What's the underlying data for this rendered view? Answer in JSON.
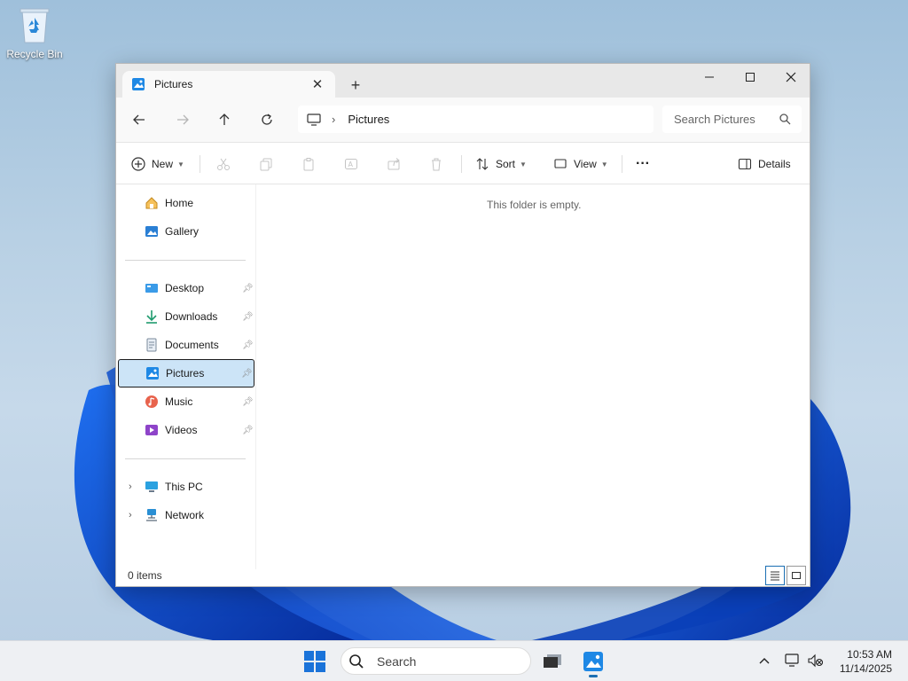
{
  "desktop": {
    "recycle_bin_label": "Recycle Bin"
  },
  "window": {
    "tab_title": "Pictures",
    "new_tab": "+",
    "address": {
      "crumb": "Pictures"
    },
    "search_placeholder": "Search Pictures",
    "toolbar": {
      "new_label": "New",
      "sort_label": "Sort",
      "view_label": "View",
      "more_label": "···",
      "details_label": "Details"
    },
    "sidebar": {
      "items": [
        {
          "label": "Home",
          "icon": "home-icon"
        },
        {
          "label": "Gallery",
          "icon": "gallery-icon"
        },
        {
          "label": "Desktop",
          "icon": "desktop-folder-icon"
        },
        {
          "label": "Downloads",
          "icon": "downloads-icon"
        },
        {
          "label": "Documents",
          "icon": "documents-icon"
        },
        {
          "label": "Pictures",
          "icon": "pictures-icon"
        },
        {
          "label": "Music",
          "icon": "music-icon"
        },
        {
          "label": "Videos",
          "icon": "videos-icon"
        },
        {
          "label": "This PC",
          "icon": "this-pc-icon"
        },
        {
          "label": "Network",
          "icon": "network-icon"
        }
      ]
    },
    "empty_message": "This folder is empty.",
    "status_items": "0 items"
  },
  "taskbar": {
    "search_label": "Search",
    "time": "10:53 AM",
    "date": "11/14/2025"
  },
  "colors": {
    "accent": "#1b6fb3",
    "selection": "#cce4f7",
    "wallpaper_blue": "#0a4fd1"
  }
}
